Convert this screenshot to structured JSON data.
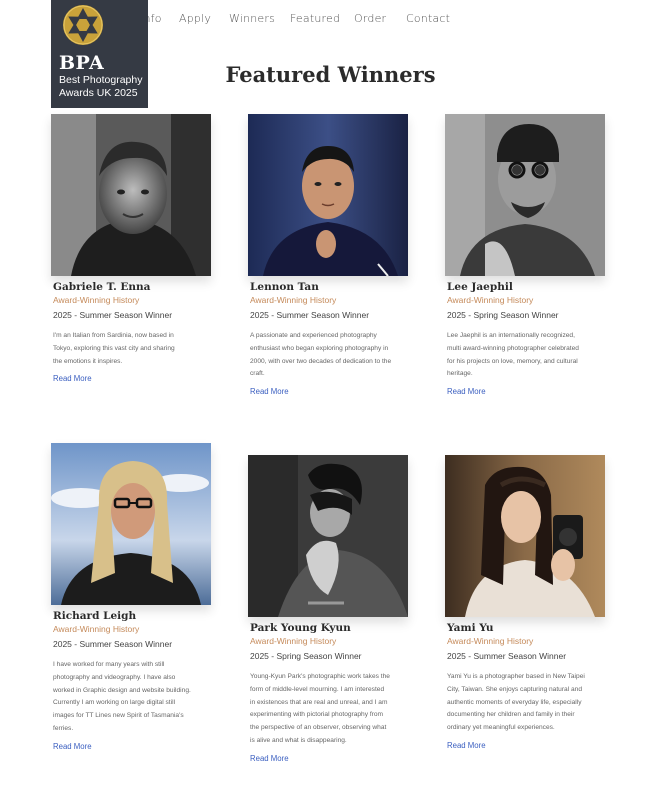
{
  "nav": {
    "items": [
      "Info",
      "Apply",
      "Winners",
      "Featured",
      "Order",
      "Contact"
    ]
  },
  "logo": {
    "abbr": "BPA",
    "name": "Best Photography Awards UK 2025",
    "icon": "camera-aperture-icon",
    "colors": {
      "bg": "#353a44",
      "gold": "#c9a23a"
    }
  },
  "page": {
    "title": "Featured Winners"
  },
  "winners": [
    {
      "name": "Gabriele T. Enna",
      "award": "Award-Winning History",
      "season": "2025 - Summer Season Winner",
      "bio": "I'm an Italian from Sardinia, now based in Tokyo, exploring this vast city and sharing the emotions it inspires.",
      "link": "Read More"
    },
    {
      "name": "Lennon Tan",
      "award": "Award-Winning History",
      "season": "2025 - Summer Season Winner",
      "bio": "A passionate and experienced photography enthusiast who began exploring photography in 2000, with over two decades of dedication to the craft.",
      "link": "Read More"
    },
    {
      "name": "Lee Jaephil",
      "award": "Award-Winning History",
      "season": "2025 - Spring Season Winner",
      "bio": "Lee Jaephil is an internationally recognized, multi award-winning photographer celebrated for his projects on love, memory, and cultural heritage.",
      "link": "Read More"
    },
    {
      "name": "Richard Leigh",
      "award": "Award-Winning History",
      "season": "2025 - Summer Season Winner",
      "bio": "I have worked for many years with still photography and videography. I have also worked in Graphic design and website building. Currently I am working on large digital still images for TT Lines new Spirit of Tasmania's ferries.",
      "link": "Read More"
    },
    {
      "name": "Park Young Kyun",
      "award": "Award-Winning History",
      "season": "2025 - Spring Season Winner",
      "bio": "Young-Kyun Park's photographic work takes the form of middle-level mourning. I am interested in existences that are real and unreal, and I am experimenting with pictorial photography from the perspective of an observer, observing what is alive and what is disappearing.",
      "link": "Read More"
    },
    {
      "name": "Yami Yu",
      "award": "Award-Winning History",
      "season": "2025 - Summer Season Winner",
      "bio": "Yami Yu is a photographer based in New Taipei City, Taiwan. She enjoys capturing natural and authentic moments of everyday life, especially documenting her children and family in their ordinary yet meaningful experiences.",
      "link": "Read More"
    }
  ]
}
